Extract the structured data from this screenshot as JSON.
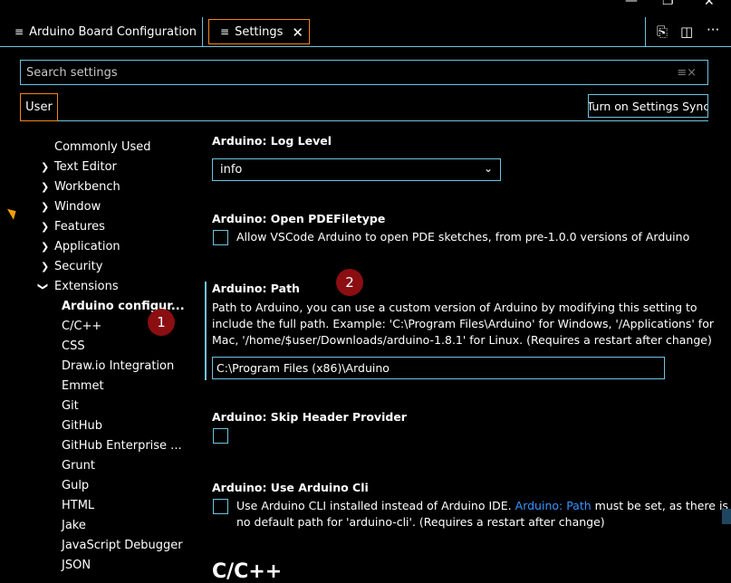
{
  "tabs": [
    {
      "label": "Arduino Board Configuration",
      "icon": "lines-icon"
    },
    {
      "label": "Settings",
      "icon": "lines-icon",
      "close": "✕"
    }
  ],
  "search": {
    "placeholder": "Search settings"
  },
  "scope": {
    "user": "User",
    "sync_button": "Turn on Settings Sync"
  },
  "toc": {
    "commonly_used": "Commonly Used",
    "text_editor": "Text Editor",
    "workbench": "Workbench",
    "window": "Window",
    "features": "Features",
    "application": "Application",
    "security": "Security",
    "extensions": "Extensions",
    "extension_items": [
      "Arduino configur...",
      "C/C++",
      "CSS",
      "Draw.io Integration",
      "Emmet",
      "Git",
      "GitHub",
      "GitHub Enterprise ...",
      "Grunt",
      "Gulp",
      "HTML",
      "Jake",
      "JavaScript Debugger",
      "JSON"
    ]
  },
  "settings": {
    "log_level": {
      "title": "Arduino: Log Level",
      "value": "info"
    },
    "open_pde": {
      "title": "Arduino: Open PDEFiletype",
      "label": "Allow VSCode Arduino to open PDE sketches, from pre-1.0.0 versions of Arduino"
    },
    "path": {
      "title": "Arduino: Path",
      "desc_line1": "Path to Arduino, you can use a custom version of Arduino by modifying this setting to",
      "desc_line2": "include the full path. Example: 'C:\\Program Files\\Arduino' for Windows, '/Applications' for",
      "desc_line3": "Mac, '/home/$user/Downloads/arduino-1.8.1' for Linux. (Requires a restart after change)",
      "value": "C:\\Program Files (x86)\\Arduino"
    },
    "skip_header": {
      "title": "Arduino: Skip Header Provider"
    },
    "use_cli": {
      "title": "Arduino: Use Arduino Cli",
      "line1_pre": "Use Arduino CLI installed instead of Arduino IDE.",
      "line1_link": "Arduino: Path",
      "line1_post": "must be set, as there is",
      "line2": "no default path for 'arduino-cli'. (Requires a restart after change)"
    },
    "next_section": "C/C++"
  },
  "annotations": {
    "badge1": "1",
    "badge2": "2"
  },
  "colors": {
    "border": "#6fc3df",
    "focus": "#f38518",
    "badge": "#8b0e12",
    "link": "#3794ff"
  }
}
